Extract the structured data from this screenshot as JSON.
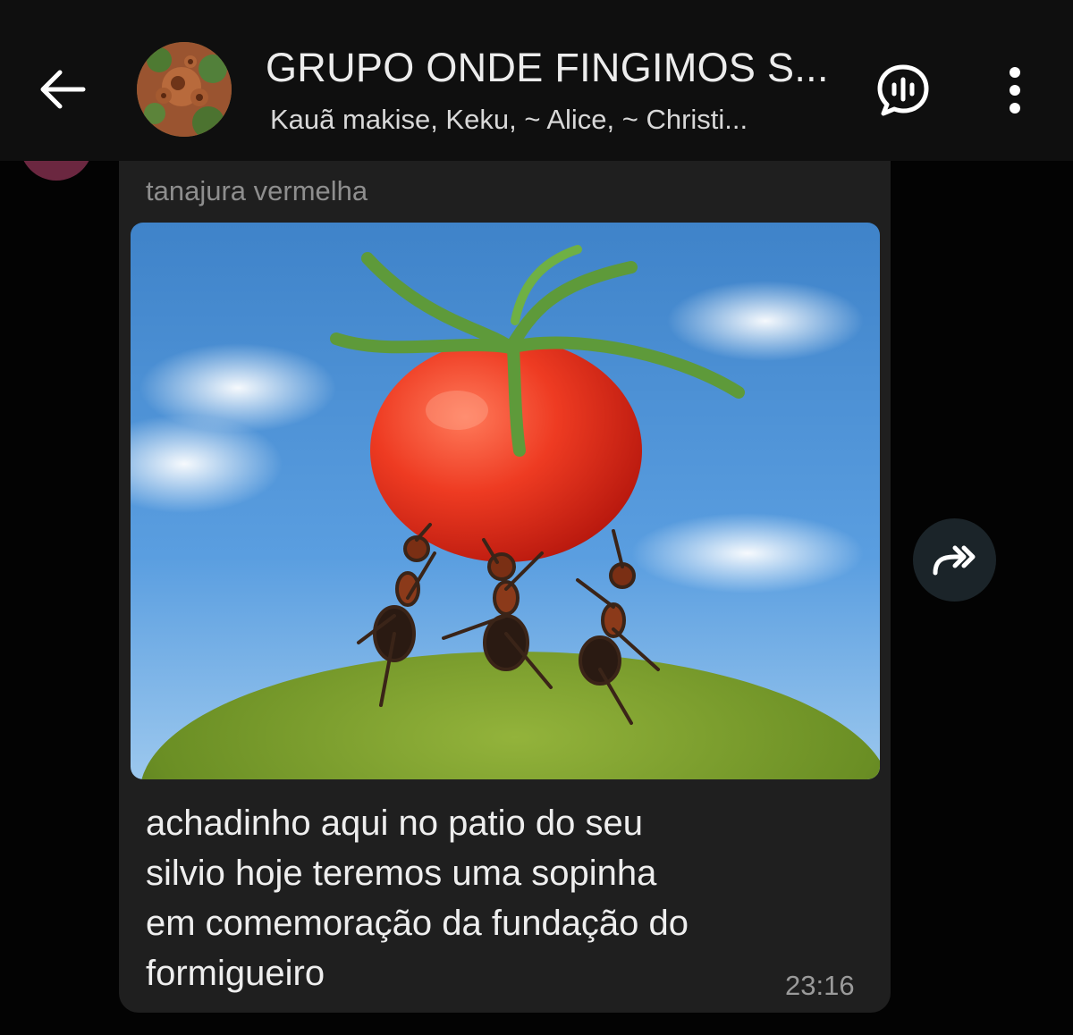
{
  "header": {
    "title": "GRUPO ONDE FINGIMOS S...",
    "members": "Kauã makise, Keku, ~ Alice, ~ Christi...",
    "back_icon": "arrow-left-icon",
    "voice_chat_icon": "voice-chat-icon",
    "menu_icon": "more-vertical-icon"
  },
  "message": {
    "sender_name": "tanajura vermelha",
    "text": "achadinho aqui no patio do seu\nsilvio hoje teremos uma sopinha\nem comemoração da fundação do\nformigueiro",
    "time": "23:16",
    "image_subject": "three ants carrying a tomato on a mossy hill under a blue sky",
    "forward_icon": "forward-icon"
  },
  "colors": {
    "background": "#030303",
    "header": "#0f0f0f",
    "bubble": "#1f1f1f",
    "sender_name": "#8e8e8e",
    "text": "#eeeeee",
    "sender_avatar": "#6b2740",
    "forward_button": "#1b2429"
  }
}
